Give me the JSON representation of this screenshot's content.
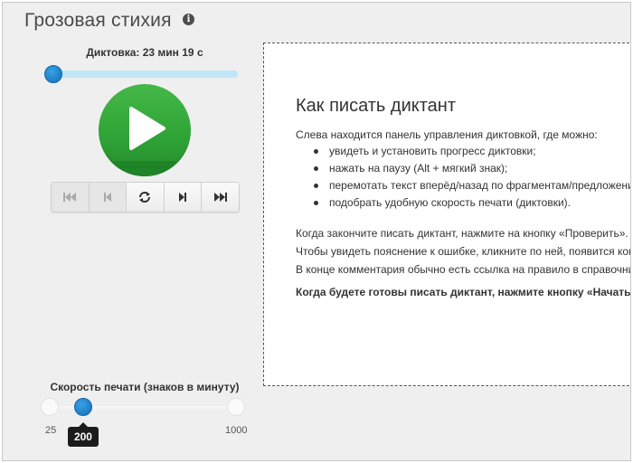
{
  "page": {
    "title": "Грозовая стихия",
    "info_icon": "info-icon"
  },
  "progress": {
    "label": "Диктовка: 23 мин 19 с",
    "value_fraction": 0.02,
    "accent": "#1c7dc7",
    "track_color": "#bfe7f7"
  },
  "player": {
    "play_icon": "play-icon",
    "play_color": "#2ea335",
    "controls": [
      {
        "icon": "skip-to-start-icon",
        "disabled": true
      },
      {
        "icon": "step-back-icon",
        "disabled": true
      },
      {
        "icon": "repeat-icon",
        "disabled": false
      },
      {
        "icon": "step-forward-icon",
        "disabled": false
      },
      {
        "icon": "skip-to-end-icon",
        "disabled": false
      }
    ]
  },
  "instructions": {
    "title": "Как писать диктант",
    "intro": "Слева находится панель управления диктовкой, где можно:",
    "bullets": [
      "увидеть и установить прогресс диктовки;",
      "нажать на паузу (Alt + мягкий знак);",
      "перемотать текст вперёд/назад по фрагментам/предложениям;",
      "подобрать удобную скорость печати (диктовки)."
    ],
    "after_lines": [
      "Когда закончите писать диктант, нажмите на кнопку «Проверить».",
      "Чтобы увидеть пояснение к ошибке, кликните по ней, появится комментарий.",
      "В конце комментария обычно есть ссылка на правило в справочнике."
    ],
    "final": "Когда будете готовы писать диктант, нажмите кнопку «Начать»."
  },
  "speed": {
    "label": "Скорость печати (знаков в минуту)",
    "min": "25",
    "max": "1000",
    "min_value": 25,
    "max_value": 1000,
    "value": "200",
    "value_number": 200
  }
}
